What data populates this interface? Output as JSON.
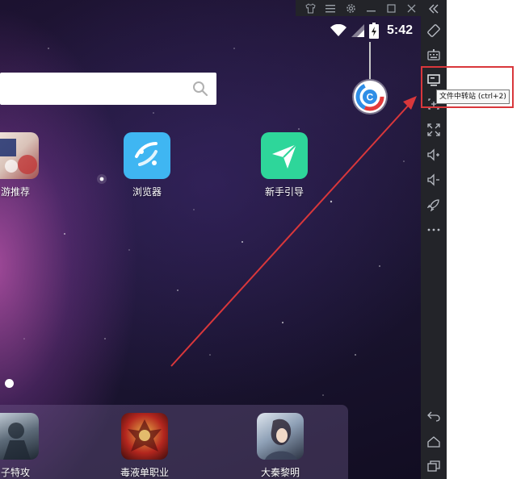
{
  "status_bar": {
    "time": "5:42"
  },
  "search": {
    "placeholder": "",
    "value": ""
  },
  "apps": [
    {
      "label": "游推荐",
      "icon": "game-recommend-icon"
    },
    {
      "label": "浏览器",
      "icon": "browser-icon"
    },
    {
      "label": "新手引导",
      "icon": "novice-guide-icon"
    }
  ],
  "dock": [
    {
      "label": "子特攻",
      "icon": "game-special-ops-icon"
    },
    {
      "label": "毒液单职业",
      "icon": "game-venom-icon"
    },
    {
      "label": "大秦黎明",
      "icon": "game-qin-dawn-icon"
    }
  ],
  "tooltip": {
    "text": "文件中转站 (ctrl+2)"
  },
  "colors": {
    "toolbar": "#232429",
    "highlight": "#d9373b",
    "browser": "#3fb6f2",
    "guide": "#2ed69a"
  }
}
